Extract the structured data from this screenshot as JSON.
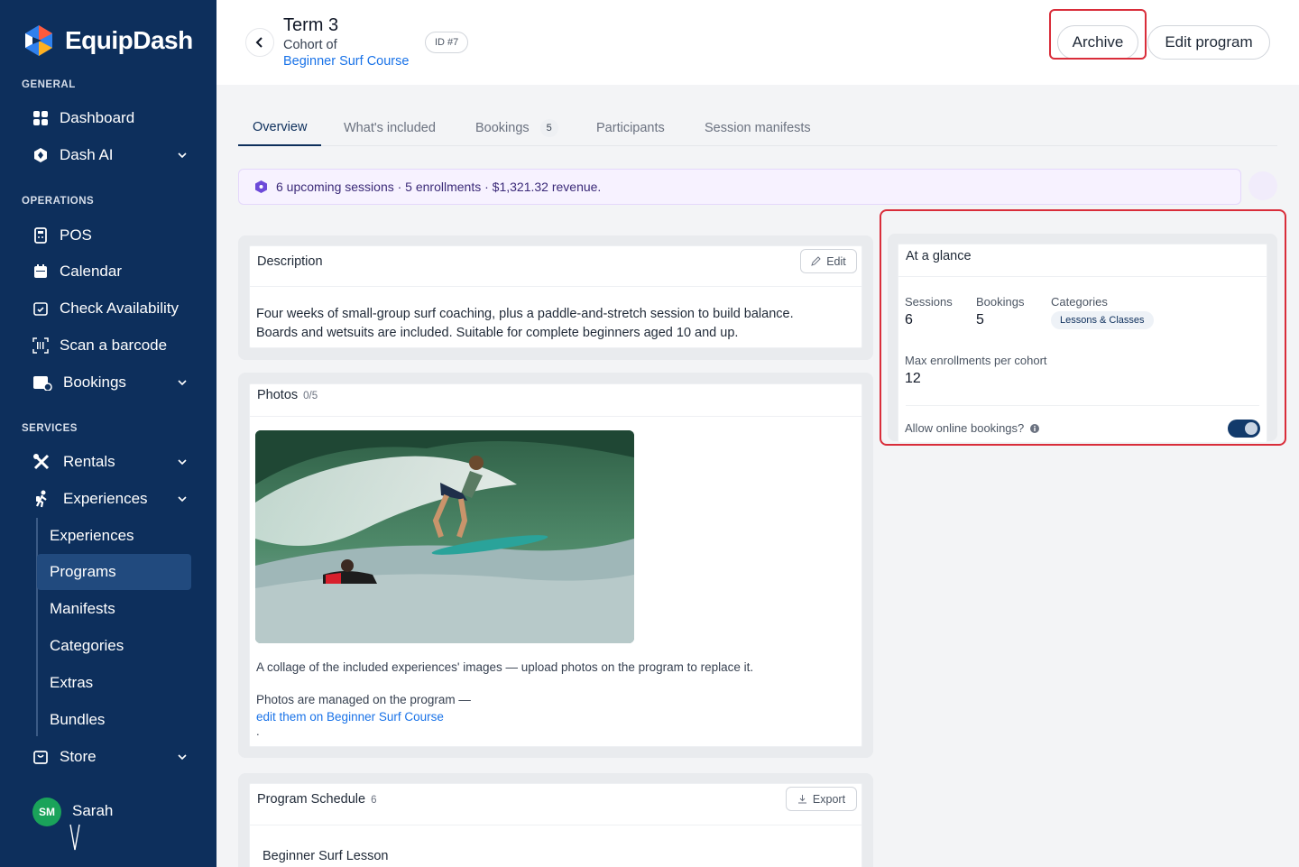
{
  "brand": {
    "name": "EquipDash"
  },
  "sidebar": {
    "sections": [
      {
        "label": "GENERAL"
      },
      {
        "label": "OPERATIONS"
      },
      {
        "label": "SERVICES"
      }
    ],
    "items": [
      {
        "label": "Dashboard"
      },
      {
        "label": "Dash AI"
      },
      {
        "label": "POS"
      },
      {
        "label": "Calendar"
      },
      {
        "label": "Check Availability"
      },
      {
        "label": "Scan a barcode"
      },
      {
        "label": "Bookings"
      },
      {
        "label": "Rentals"
      },
      {
        "label": "Experiences"
      },
      {
        "label": "Store"
      }
    ],
    "subitems": [
      {
        "label": "Experiences"
      },
      {
        "label": "Programs",
        "active": true
      },
      {
        "label": "Manifests"
      },
      {
        "label": "Categories"
      },
      {
        "label": "Extras"
      },
      {
        "label": "Bundles"
      }
    ],
    "user": {
      "initials": "SM",
      "name": "Sarah"
    }
  },
  "header": {
    "title": "Term 3",
    "subtitle": "Cohort of",
    "course_link": "Beginner Surf Course",
    "id_badge": "ID #7",
    "archive_label": "Archive",
    "edit_label": "Edit program"
  },
  "tabs": [
    {
      "label": "Overview",
      "active": true
    },
    {
      "label": "What's included"
    },
    {
      "label": "Bookings",
      "count": "5"
    },
    {
      "label": "Participants"
    },
    {
      "label": "Session manifests"
    }
  ],
  "banner": {
    "text": "6 upcoming sessions · 5 enrollments · $1,321.32 revenue."
  },
  "description": {
    "title": "Description",
    "edit_label": "Edit",
    "line1": "Four weeks of small-group surf coaching, plus a paddle-and-stretch session to build balance.",
    "line2": "Boards and wetsuits are included. Suitable for complete beginners aged 10 and up."
  },
  "photos": {
    "title": "Photos",
    "count": "0/5",
    "caption": "A collage of the included experiences' images — upload photos on the program to replace it.",
    "managed_text": "Photos are managed on the program —",
    "managed_link": "edit them on Beginner Surf Course",
    "trailing": "."
  },
  "schedule": {
    "title": "Program Schedule",
    "count": "6",
    "export_label": "Export",
    "first_item": "Beginner Surf Lesson"
  },
  "glance": {
    "title": "At a glance",
    "sessions_label": "Sessions",
    "sessions_value": "6",
    "bookings_label": "Bookings",
    "bookings_value": "5",
    "categories_label": "Categories",
    "category": "Lessons & Classes",
    "max_label": "Max enrollments per cohort",
    "max_value": "12",
    "online_label": "Allow online bookings?",
    "online_enabled": true
  },
  "colors": {
    "sidebar_bg": "#0d2f5c",
    "accent_link": "#1a73e8",
    "highlight_red": "#d92d3a",
    "banner_bg": "#f7f2ff"
  }
}
